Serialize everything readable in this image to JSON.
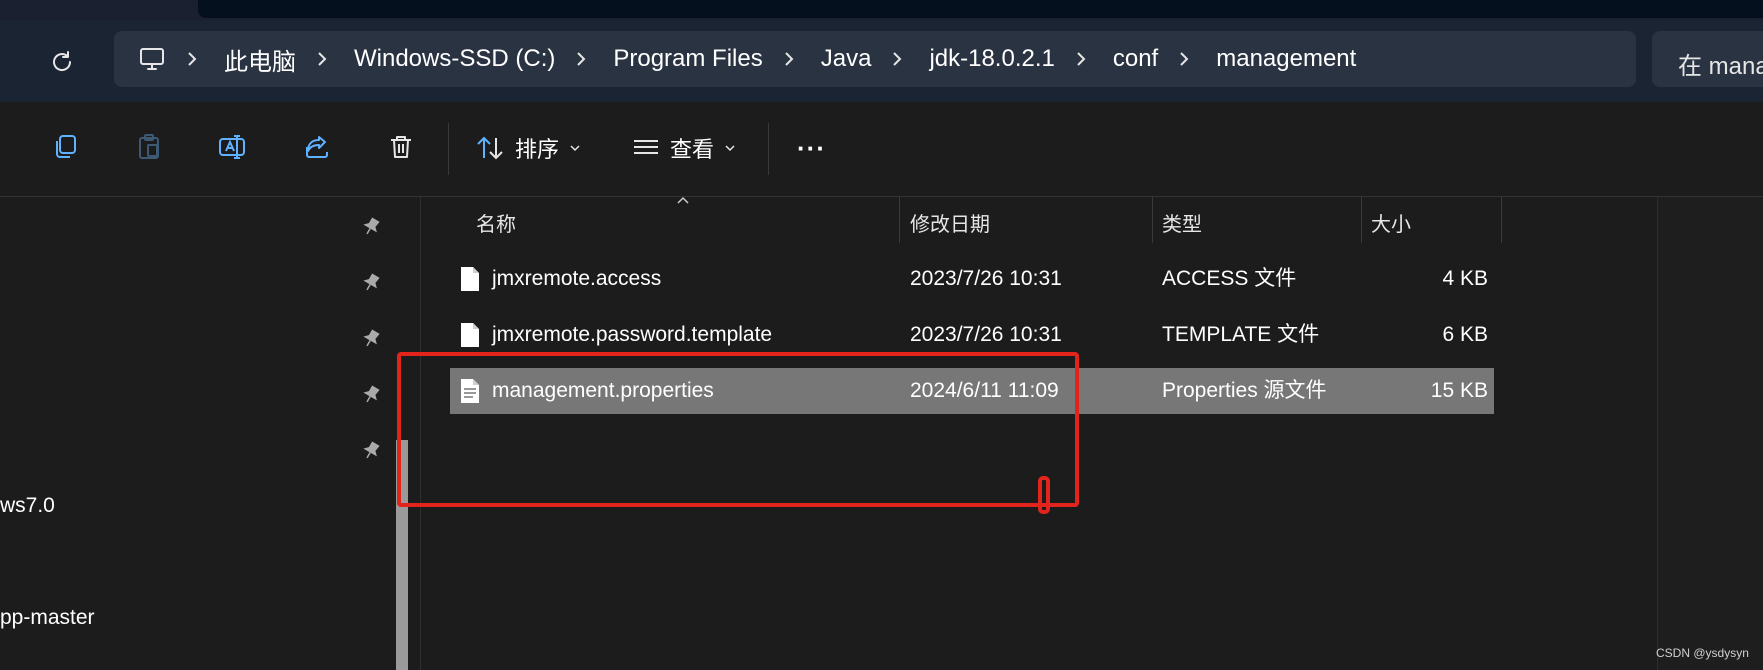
{
  "address_bar": {
    "breadcrumbs": [
      "此电脑",
      "Windows-SSD (C:)",
      "Program Files",
      "Java",
      "jdk-18.0.2.1",
      "conf",
      "management"
    ],
    "search_placeholder": "在 mana"
  },
  "toolbar": {
    "sort_label": "排序",
    "view_label": "查看",
    "more_label": "···"
  },
  "nav": {
    "items": [
      "ws7.0",
      "pp-master"
    ]
  },
  "columns": {
    "name": "名称",
    "modified": "修改日期",
    "type": "类型",
    "size": "大小"
  },
  "files": [
    {
      "name": "jmxremote.access",
      "modified": "2023/7/26 10:31",
      "type": "ACCESS 文件",
      "size": "4 KB",
      "selected": false
    },
    {
      "name": "jmxremote.password.template",
      "modified": "2023/7/26 10:31",
      "type": "TEMPLATE 文件",
      "size": "6 KB",
      "selected": false
    },
    {
      "name": "management.properties",
      "modified": "2024/6/11 11:09",
      "type": "Properties 源文件",
      "size": "15 KB",
      "selected": true
    }
  ],
  "watermark": "CSDN @ysdysyn",
  "colors": {
    "annotation": "#e2241d",
    "selection": "#777777",
    "address_bg": "#2a3342"
  }
}
